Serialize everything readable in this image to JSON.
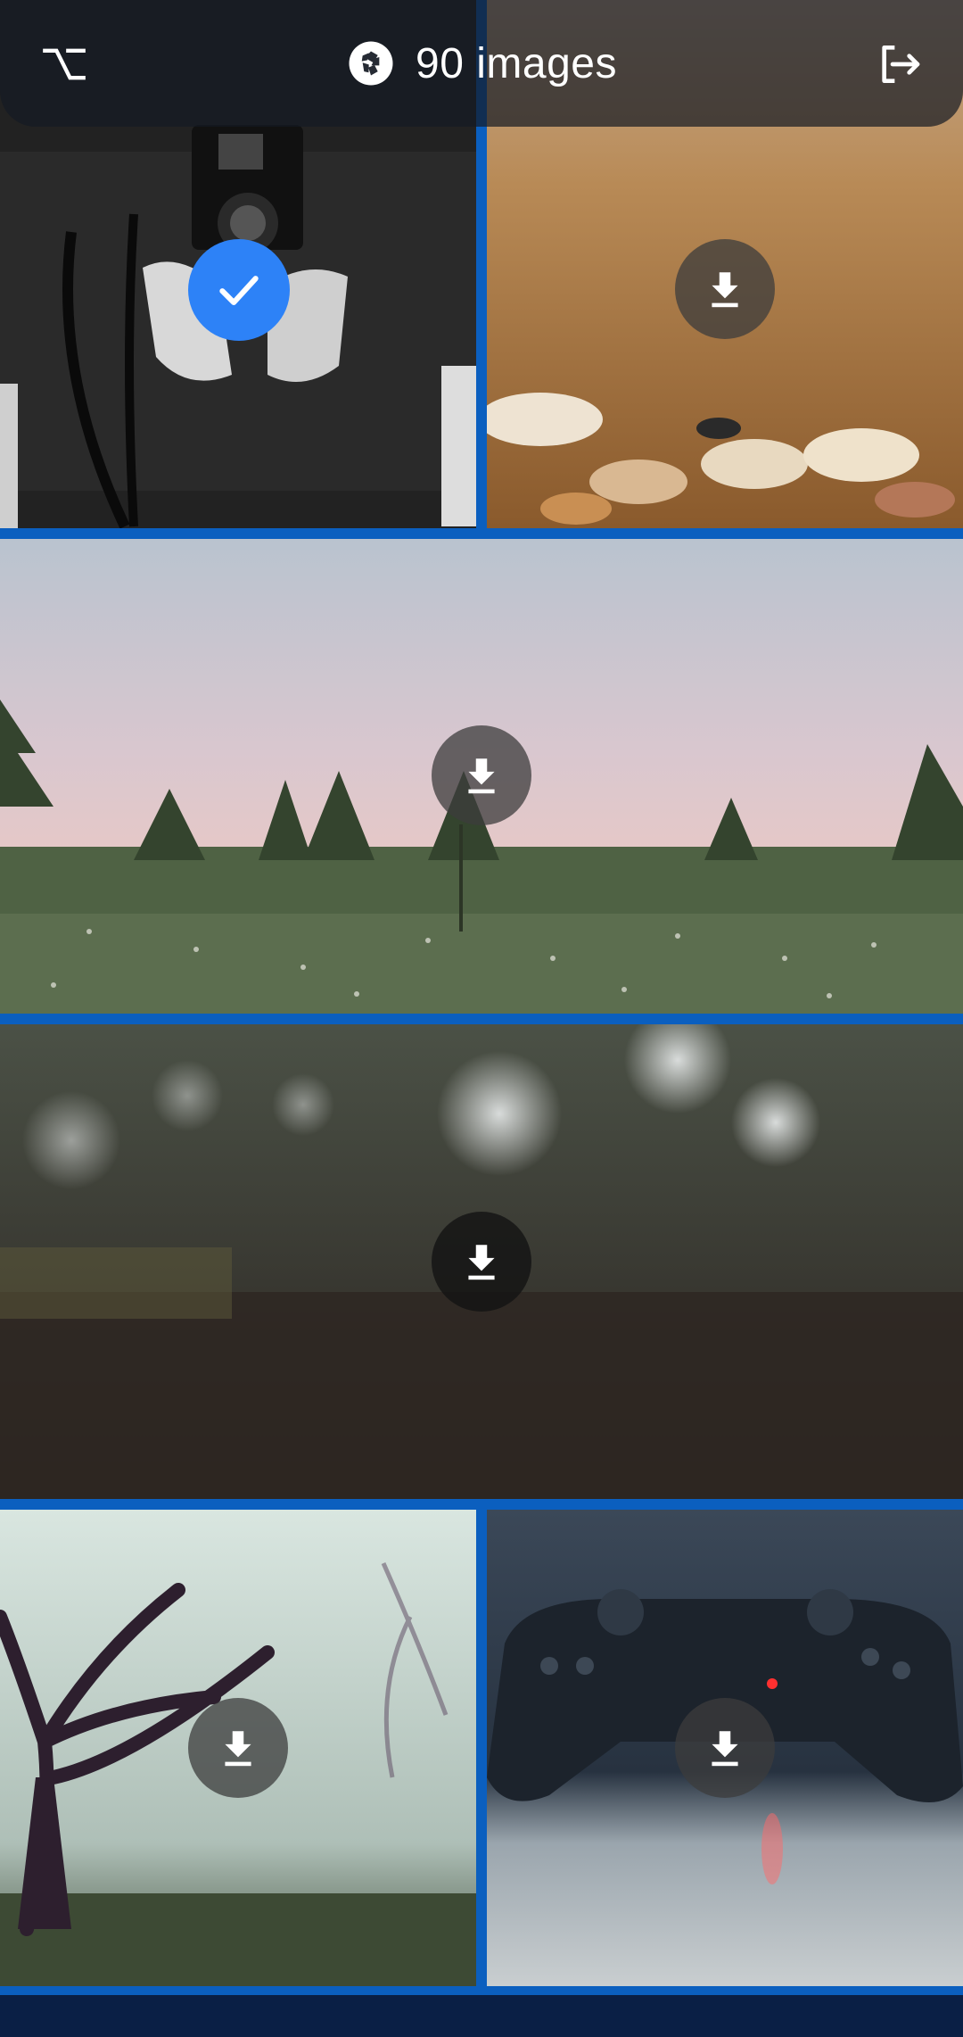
{
  "header": {
    "title": "90 images",
    "left_icon": "alt-key-icon",
    "center_icon": "camera-aperture-icon",
    "right_icon": "exit-icon"
  },
  "colors": {
    "grid_background": "#0b5fbf",
    "selected_accent": "#2d82f7",
    "header_overlay": "rgba(20,25,35,0.70)"
  },
  "tiles": [
    {
      "subject": "camera-photo",
      "state": "selected",
      "overlay_icon": "checkmark-icon"
    },
    {
      "subject": "seashells-photo",
      "state": "not-downloaded",
      "overlay_icon": "download-icon"
    },
    {
      "subject": "meadow-photo",
      "state": "not-downloaded",
      "overlay_icon": "download-icon"
    },
    {
      "subject": "bokeh-forest-photo",
      "state": "not-downloaded",
      "overlay_icon": "download-icon"
    },
    {
      "subject": "foggy-tree-photo",
      "state": "not-downloaded",
      "overlay_icon": "download-icon"
    },
    {
      "subject": "game-controller-photo",
      "state": "not-downloaded",
      "overlay_icon": "download-icon"
    }
  ]
}
